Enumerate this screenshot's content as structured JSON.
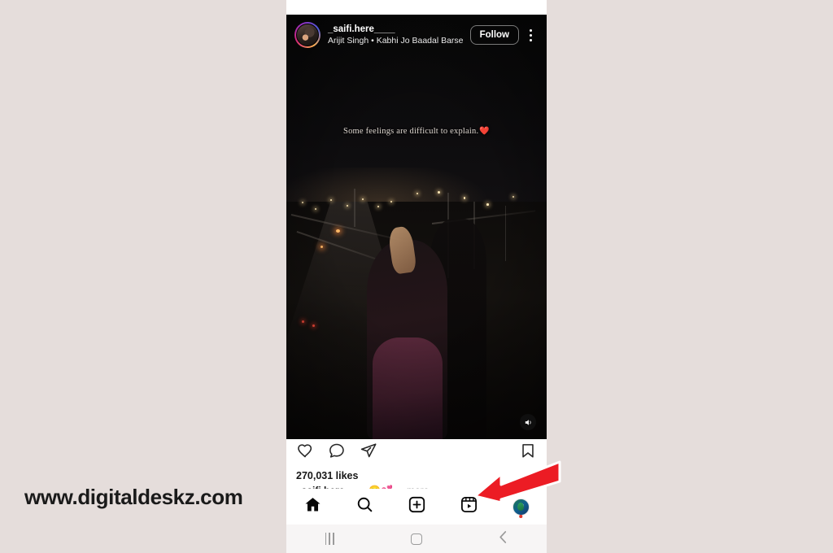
{
  "watermark": {
    "text": "www.digitaldeskz.com"
  },
  "post": {
    "username": "_saifi.here____",
    "audio": "Arijit Singh • Kabhi Jo Baadal Barse",
    "follow_label": "Follow",
    "menu_icon": "kebab-menu-icon",
    "avatar_icon": "story-avatar",
    "caption_overlay": "Some feelings are difficult to explain.",
    "caption_overlay_emoji": "❤️",
    "sound_icon": "speaker-icon"
  },
  "actions": {
    "like_icon": "heart-icon",
    "comment_icon": "comment-icon",
    "share_icon": "share-icon",
    "save_icon": "bookmark-icon",
    "likes_text": "270,031 likes",
    "caption_user": "_saifi.here____",
    "caption_body": "😊💕",
    "caption_more": "... more"
  },
  "bottom_nav": {
    "items": [
      {
        "name": "home",
        "label": "Home",
        "icon": "home-icon",
        "active": true
      },
      {
        "name": "search",
        "label": "Search",
        "icon": "search-icon",
        "active": false
      },
      {
        "name": "create",
        "label": "Create",
        "icon": "plus-square-icon",
        "active": false
      },
      {
        "name": "reels",
        "label": "Reels",
        "icon": "reels-icon",
        "active": false
      },
      {
        "name": "profile",
        "label": "Profile",
        "icon": "profile-avatar-icon",
        "active": false
      }
    ]
  },
  "system_nav": {
    "recents_label": "Recents",
    "home_label": "Home",
    "back_label": "Back"
  },
  "annotation": {
    "arrow_color": "#ec1c24",
    "arrow_target": "reels-tab",
    "arrow_label": "red-pointer-arrow"
  },
  "colors": {
    "page_background": "#e5dddb",
    "phone_background": "#ffffff",
    "video_background": "#000000",
    "text_primary": "#161616",
    "text_muted": "#8e8e8e",
    "accent_red": "#ec1c24"
  }
}
